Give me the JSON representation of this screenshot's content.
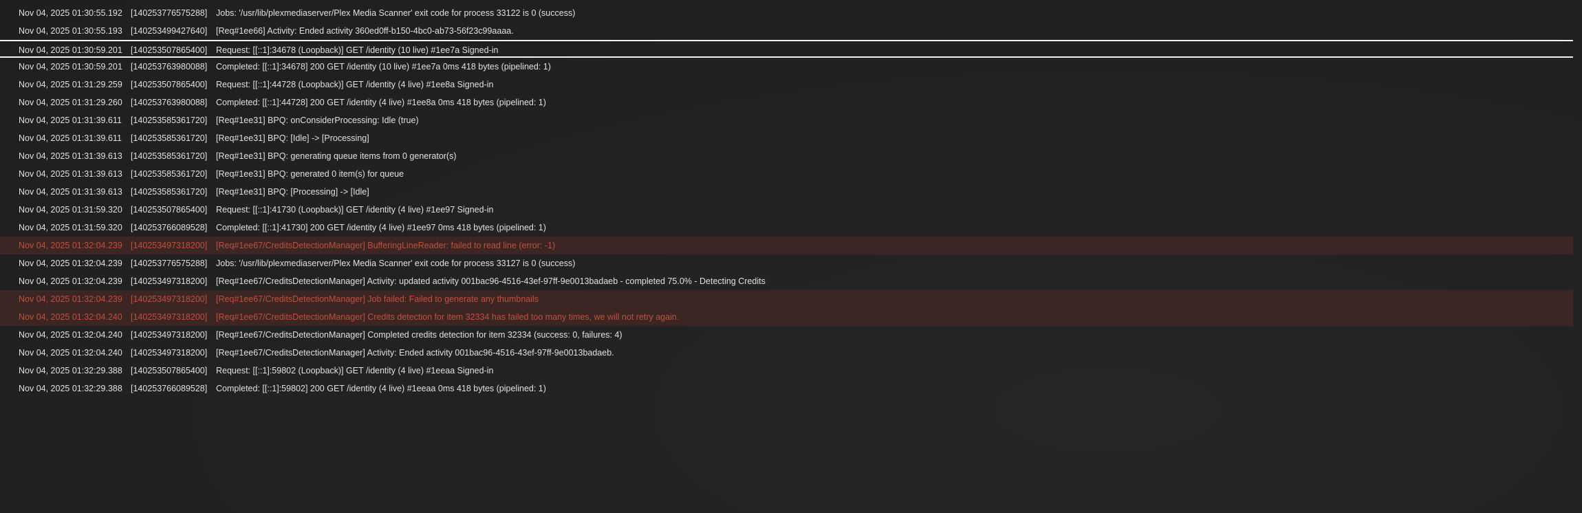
{
  "log": {
    "rows": [
      {
        "time": "Nov 04, 2025 01:30:55.192",
        "thread": "[140253776575288]",
        "message": "Jobs: '/usr/lib/plexmediaserver/Plex Media Scanner' exit code for process 33122 is 0 (success)",
        "level": "info"
      },
      {
        "time": "Nov 04, 2025 01:30:55.193",
        "thread": "[140253499427640]",
        "message": "[Req#1ee66] Activity: Ended activity 360ed0ff-b150-4bc0-ab73-56f23c99aaaa.",
        "level": "info"
      },
      {
        "time": "Nov 04, 2025 01:30:59.201",
        "thread": "[140253507865400]",
        "message": "Request: [[::1]:34678 (Loopback)] GET /identity (10 live) #1ee7a Signed-in",
        "level": "info",
        "selected": true
      },
      {
        "time": "Nov 04, 2025 01:30:59.201",
        "thread": "[140253763980088]",
        "message": "Completed: [[::1]:34678] 200 GET /identity (10 live) #1ee7a 0ms 418 bytes (pipelined: 1)",
        "level": "info"
      },
      {
        "time": "Nov 04, 2025 01:31:29.259",
        "thread": "[140253507865400]",
        "message": "Request: [[::1]:44728 (Loopback)] GET /identity (4 live) #1ee8a Signed-in",
        "level": "info"
      },
      {
        "time": "Nov 04, 2025 01:31:29.260",
        "thread": "[140253763980088]",
        "message": "Completed: [[::1]:44728] 200 GET /identity (4 live) #1ee8a 0ms 418 bytes (pipelined: 1)",
        "level": "info"
      },
      {
        "time": "Nov 04, 2025 01:31:39.611",
        "thread": "[140253585361720]",
        "message": "[Req#1ee31] BPQ: onConsiderProcessing: Idle (true)",
        "level": "info"
      },
      {
        "time": "Nov 04, 2025 01:31:39.611",
        "thread": "[140253585361720]",
        "message": "[Req#1ee31] BPQ: [Idle] -> [Processing]",
        "level": "info"
      },
      {
        "time": "Nov 04, 2025 01:31:39.613",
        "thread": "[140253585361720]",
        "message": "[Req#1ee31] BPQ: generating queue items from 0 generator(s)",
        "level": "info"
      },
      {
        "time": "Nov 04, 2025 01:31:39.613",
        "thread": "[140253585361720]",
        "message": "[Req#1ee31] BPQ: generated 0 item(s) for queue",
        "level": "info"
      },
      {
        "time": "Nov 04, 2025 01:31:39.613",
        "thread": "[140253585361720]",
        "message": "[Req#1ee31] BPQ: [Processing] -> [Idle]",
        "level": "info"
      },
      {
        "time": "Nov 04, 2025 01:31:59.320",
        "thread": "[140253507865400]",
        "message": "Request: [[::1]:41730 (Loopback)] GET /identity (4 live) #1ee97 Signed-in",
        "level": "info"
      },
      {
        "time": "Nov 04, 2025 01:31:59.320",
        "thread": "[140253766089528]",
        "message": "Completed: [[::1]:41730] 200 GET /identity (4 live) #1ee97 0ms 418 bytes (pipelined: 1)",
        "level": "info"
      },
      {
        "time": "Nov 04, 2025 01:32:04.239",
        "thread": "[140253497318200]",
        "message": "[Req#1ee67/CreditsDetectionManager] BufferingLineReader: failed to read line (error: -1)",
        "level": "error"
      },
      {
        "time": "Nov 04, 2025 01:32:04.239",
        "thread": "[140253776575288]",
        "message": "Jobs: '/usr/lib/plexmediaserver/Plex Media Scanner' exit code for process 33127 is 0 (success)",
        "level": "info"
      },
      {
        "time": "Nov 04, 2025 01:32:04.239",
        "thread": "[140253497318200]",
        "message": "[Req#1ee67/CreditsDetectionManager] Activity: updated activity 001bac96-4516-43ef-97ff-9e0013badaeb - completed 75.0% - Detecting Credits",
        "level": "info"
      },
      {
        "time": "Nov 04, 2025 01:32:04.239",
        "thread": "[140253497318200]",
        "message": "[Req#1ee67/CreditsDetectionManager] Job failed: Failed to generate any thumbnails",
        "level": "error"
      },
      {
        "time": "Nov 04, 2025 01:32:04.240",
        "thread": "[140253497318200]",
        "message": "[Req#1ee67/CreditsDetectionManager] Credits detection for item 32334 has failed too many times, we will not retry again.",
        "level": "error"
      },
      {
        "time": "Nov 04, 2025 01:32:04.240",
        "thread": "[140253497318200]",
        "message": "[Req#1ee67/CreditsDetectionManager] Completed credits detection for item 32334 (success: 0, failures: 4)",
        "level": "info"
      },
      {
        "time": "Nov 04, 2025 01:32:04.240",
        "thread": "[140253497318200]",
        "message": "[Req#1ee67/CreditsDetectionManager] Activity: Ended activity 001bac96-4516-43ef-97ff-9e0013badaeb.",
        "level": "info"
      },
      {
        "time": "Nov 04, 2025 01:32:29.388",
        "thread": "[140253507865400]",
        "message": "Request: [[::1]:59802 (Loopback)] GET /identity (4 live) #1eeaa Signed-in",
        "level": "info"
      },
      {
        "time": "Nov 04, 2025 01:32:29.388",
        "thread": "[140253766089528]",
        "message": "Completed: [[::1]:59802] 200 GET /identity (4 live) #1eeaa 0ms 418 bytes (pipelined: 1)",
        "level": "info"
      }
    ]
  },
  "colors": {
    "background": "#222222",
    "text": "#e0e0e0",
    "error_text": "#c0503e",
    "error_background": "#3b2623",
    "selection_border": "#f2f2f2"
  }
}
